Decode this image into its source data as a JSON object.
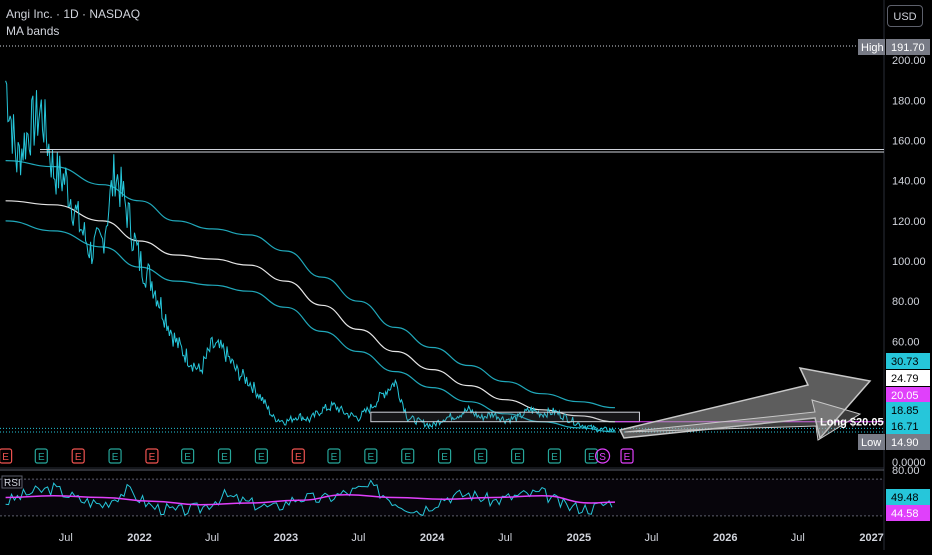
{
  "header": {
    "title": "Angi Inc. · 1D · NASDAQ",
    "indicator": "MA bands",
    "currency_button": "USD",
    "rsi_label": "RSI"
  },
  "colors": {
    "background": "#000000",
    "price_line": "#26c6da",
    "ma_center": "#ffffff",
    "ma_band": "#26c6da",
    "rsi_line": "#26c6da",
    "rsi_ma": "#e040fb",
    "earnings_marker": "#ef5350",
    "earnings_marker_alt": "#26a69a",
    "magenta": "#e040fb",
    "arrow": "#a9a9a9",
    "axis_text": "#d1d4dc"
  },
  "chart_data": [
    {
      "type": "line",
      "title": "Angi Inc. · 1D · NASDAQ",
      "x_ticks": [
        "Jul",
        "2022",
        "Jul",
        "2023",
        "Jul",
        "2024",
        "Jul",
        "2025",
        "Jul",
        "2026",
        "Jul",
        "2027"
      ],
      "y_ticks": [
        0.0,
        20.0,
        40.0,
        60.0,
        80.0,
        100.0,
        120.0,
        140.0,
        160.0,
        180.0,
        200.0
      ],
      "y_tick_labels": [
        "0.0000",
        "20.00",
        "40.00",
        "60.00",
        "80.00",
        "100.00",
        "120.00",
        "140.00",
        "160.00",
        "180.00",
        "200.00"
      ],
      "ylim": [
        0,
        210
      ],
      "x_axis": "date",
      "series": [
        {
          "style": "price",
          "x": [
            "2021-02",
            "2021-03",
            "2021-04",
            "2021-05",
            "2021-06",
            "2021-07",
            "2021-08",
            "2021-09",
            "2021-10",
            "2021-11",
            "2021-12",
            "2022-01",
            "2022-02",
            "2022-03",
            "2022-04",
            "2022-05",
            "2022-06",
            "2022-07",
            "2022-08",
            "2022-09",
            "2022-10",
            "2022-11",
            "2022-12",
            "2023-01",
            "2023-02",
            "2023-03",
            "2023-04",
            "2023-05",
            "2023-06",
            "2023-07",
            "2023-08",
            "2023-09",
            "2023-10",
            "2023-11",
            "2023-12",
            "2024-01",
            "2024-02",
            "2024-03",
            "2024-04",
            "2024-05",
            "2024-06",
            "2024-07",
            "2024-08",
            "2024-09",
            "2024-10",
            "2024-11",
            "2024-12",
            "2025-01",
            "2025-02",
            "2025-03",
            "2025-04"
          ],
          "values": [
            190,
            150,
            165,
            175,
            145,
            140,
            120,
            105,
            110,
            145,
            125,
            100,
            90,
            75,
            60,
            52,
            45,
            58,
            55,
            45,
            40,
            32,
            22,
            20,
            23,
            21,
            26,
            28,
            24,
            22,
            27,
            34,
            40,
            22,
            20,
            18,
            22,
            23,
            26,
            22,
            24,
            21,
            22,
            26,
            24,
            25,
            22,
            19,
            17,
            16,
            16
          ]
        },
        {
          "name": "",
          "style": "ma_center",
          "x": [
            "2021-02",
            "2021-06",
            "2021-10",
            "2022-01",
            "2022-04",
            "2022-07",
            "2022-10",
            "2023-01",
            "2023-04",
            "2023-07",
            "2023-10",
            "2024-01",
            "2024-04",
            "2024-07",
            "2024-10",
            "2025-01",
            "2025-04"
          ],
          "values": [
            130,
            128,
            120,
            110,
            103,
            101,
            98,
            90,
            78,
            66,
            55,
            46,
            38,
            31,
            26,
            23,
            20
          ]
        },
        {
          "name": "",
          "style": "ma_upper",
          "x": [
            "2021-02",
            "2021-06",
            "2021-10",
            "2022-01",
            "2022-04",
            "2022-07",
            "2022-10",
            "2023-01",
            "2023-04",
            "2023-07",
            "2023-10",
            "2024-01",
            "2024-04",
            "2024-07",
            "2024-10",
            "2025-01",
            "2025-04"
          ],
          "values": [
            150,
            147,
            138,
            130,
            120,
            116,
            113,
            105,
            92,
            80,
            67,
            57,
            48,
            40,
            34,
            30,
            27
          ]
        },
        {
          "name": "",
          "style": "ma_lower",
          "x": [
            "2021-02",
            "2021-06",
            "2021-10",
            "2022-01",
            "2022-04",
            "2022-07",
            "2022-10",
            "2023-01",
            "2023-04",
            "2023-07",
            "2023-10",
            "2024-01",
            "2024-04",
            "2024-07",
            "2024-10",
            "2025-01",
            "2025-04"
          ],
          "values": [
            120,
            115,
            107,
            97,
            90,
            88,
            85,
            77,
            65,
            55,
            45,
            37,
            30,
            24,
            20,
            17,
            15
          ]
        }
      ],
      "price_labels": [
        {
          "label": "High",
          "value": "191.70"
        },
        {
          "value": "30.73"
        },
        {
          "value": "24.79"
        },
        {
          "value": "20.05"
        },
        {
          "value": "18.85"
        },
        {
          "value": "16.71"
        },
        {
          "label": "Low",
          "value": "14.90"
        }
      ],
      "annotations": [
        {
          "text": "Long $20.05"
        }
      ],
      "event_markers": [
        "E",
        "E",
        "E",
        "E",
        "E",
        "E",
        "E",
        "E",
        "E",
        "E",
        "E",
        "E",
        "E",
        "E",
        "E",
        "E",
        "E",
        "S",
        "E"
      ]
    },
    {
      "type": "line",
      "title": "RSI",
      "y_tick_labels": [
        "80.00"
      ],
      "ylim": [
        20,
        80
      ],
      "x_axis": "date",
      "series": [
        {
          "style": "rsi",
          "x": [
            "2021-02",
            "2021-04",
            "2021-06",
            "2021-08",
            "2021-10",
            "2021-12",
            "2022-02",
            "2022-04",
            "2022-06",
            "2022-08",
            "2022-10",
            "2022-12",
            "2023-02",
            "2023-04",
            "2023-06",
            "2023-08",
            "2023-10",
            "2023-12",
            "2024-02",
            "2024-04",
            "2024-06",
            "2024-08",
            "2024-10",
            "2024-12",
            "2025-02",
            "2025-04"
          ],
          "values": [
            45,
            55,
            60,
            48,
            42,
            58,
            40,
            35,
            38,
            52,
            44,
            38,
            50,
            48,
            55,
            62,
            45,
            35,
            50,
            54,
            46,
            52,
            55,
            40,
            38,
            47
          ]
        },
        {
          "style": "rsi_ma",
          "x": [
            "2021-02",
            "2021-06",
            "2021-10",
            "2022-02",
            "2022-06",
            "2022-10",
            "2023-02",
            "2023-06",
            "2023-10",
            "2024-02",
            "2024-06",
            "2024-10",
            "2025-02",
            "2025-04"
          ],
          "values": [
            50,
            52,
            50,
            46,
            42,
            44,
            47,
            53,
            50,
            48,
            50,
            52,
            44,
            45
          ]
        }
      ],
      "price_labels": [
        {
          "value": "49.48"
        },
        {
          "value": "44.58"
        }
      ]
    }
  ]
}
